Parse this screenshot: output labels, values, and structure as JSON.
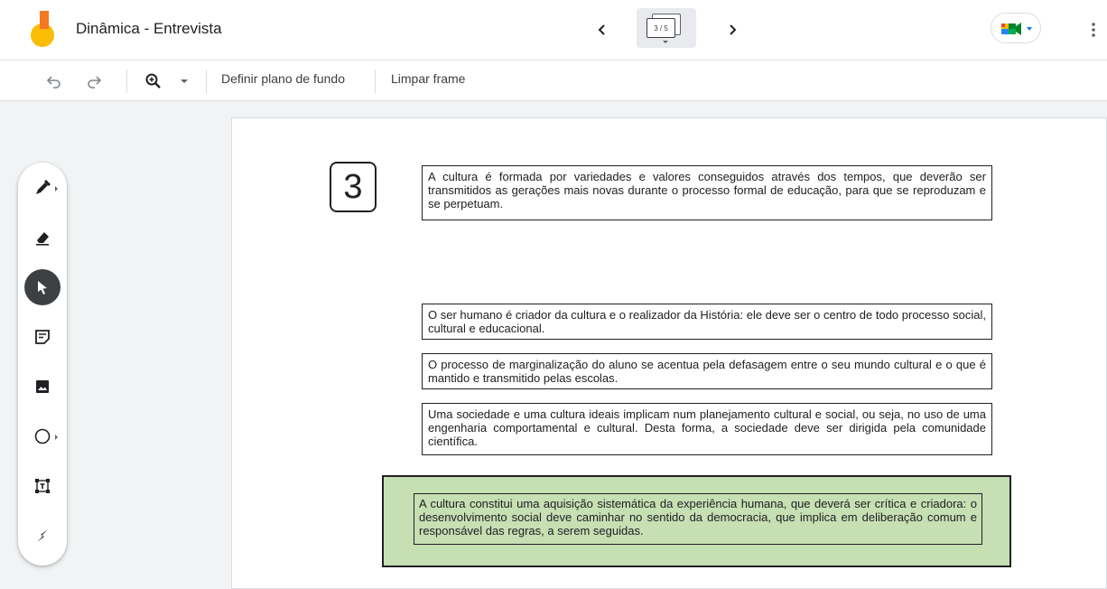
{
  "appbar": {
    "title": "Dinâmica - Entrevista",
    "frame_indicator": "3 / 5"
  },
  "toolbar": {
    "set_background_label": "Definir plano de fundo",
    "clear_frame_label": "Limpar frame"
  },
  "sidetools": [
    {
      "name": "pen-tool",
      "icon": "pen-icon"
    },
    {
      "name": "eraser-tool",
      "icon": "eraser-icon"
    },
    {
      "name": "select-tool",
      "icon": "cursor-icon",
      "active": true
    },
    {
      "name": "sticky-note-tool",
      "icon": "sticky-note-icon"
    },
    {
      "name": "image-tool",
      "icon": "image-icon"
    },
    {
      "name": "shape-tool",
      "icon": "circle-icon"
    },
    {
      "name": "textbox-tool",
      "icon": "textbox-icon"
    },
    {
      "name": "laser-tool",
      "icon": "laser-icon"
    }
  ],
  "canvas": {
    "frame_number": "3",
    "boxes": [
      "A cultura é formada por variedades e valores conseguidos através dos tempos, que deverão ser transmitidos as gerações mais novas durante o processo formal de educação, para que se reproduzam e se perpetuam.",
      "O ser humano é criador da cultura e o realizador da História: ele deve ser o centro de todo processo social, cultural e educacional.",
      "O processo de marginalização do aluno se acentua pela defasagem entre o seu mundo cultural e o que é mantido e transmitido pelas escolas.",
      "Uma sociedade e uma cultura ideais implicam num planejamento cultural e social, ou seja, no uso de uma engenharia comportamental e cultural. Desta forma, a sociedade deve ser dirigida pela comunidade científica."
    ],
    "highlighted_box": "A cultura constitui uma aquisição sistemática da experiência humana, que deverá ser crítica e criadora: o desenvolvimento social deve caminhar no sentido da democracia, que implica em deliberação comum e responsável das regras, a serem seguidas."
  },
  "colors": {
    "highlight_green": "#c6dfb3",
    "active_tool": "#3c4043",
    "logo_orange": "#f4781f",
    "logo_yellow": "#fbbc04"
  }
}
